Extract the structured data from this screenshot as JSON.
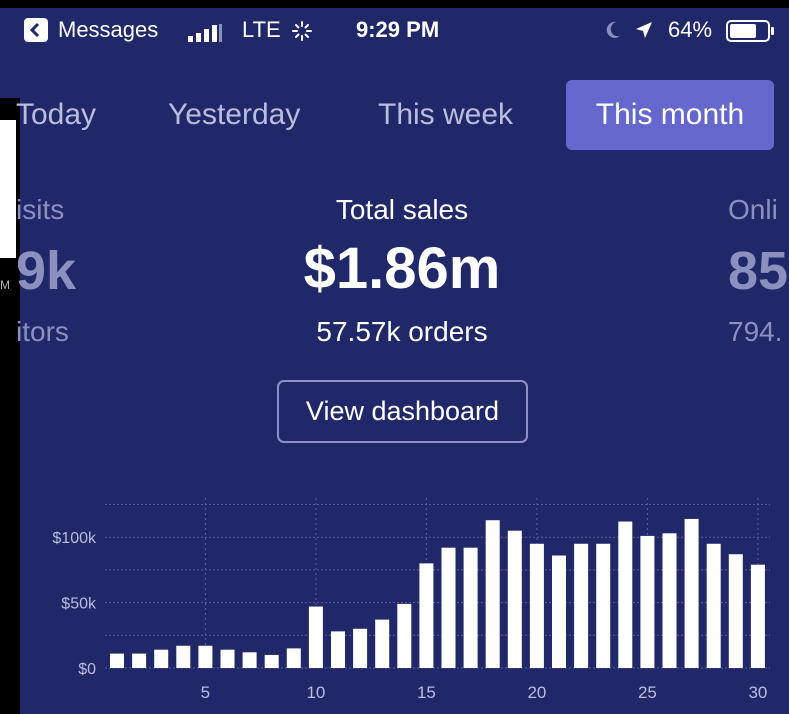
{
  "status_bar": {
    "back_app": "Messages",
    "network": "LTE",
    "time": "9:29 PM",
    "battery_percent": "64%"
  },
  "tabs": [
    {
      "label": "Today",
      "selected": false
    },
    {
      "label": "Yesterday",
      "selected": false
    },
    {
      "label": "This week",
      "selected": false
    },
    {
      "label": "This month",
      "selected": true
    }
  ],
  "left_card": {
    "caption": "isits",
    "value": "9k",
    "sub": "itors"
  },
  "main_card": {
    "caption": "Total sales",
    "value": "$1.86m",
    "sub": "57.57k orders"
  },
  "right_card": {
    "caption": "Onli",
    "value": "85",
    "sub": "794."
  },
  "view_dashboard_label": "View dashboard",
  "left_edge_glyph": "M",
  "colors": {
    "background": "#21286a",
    "tab_selected": "#6667cc",
    "bar": "#ffffff"
  },
  "chart_data": {
    "type": "bar",
    "x": [
      1,
      2,
      3,
      4,
      5,
      6,
      7,
      8,
      9,
      10,
      11,
      12,
      13,
      14,
      15,
      16,
      17,
      18,
      19,
      20,
      21,
      22,
      23,
      24,
      25,
      26,
      27,
      28,
      29,
      30
    ],
    "values": [
      11,
      11,
      14,
      17,
      17,
      14,
      12,
      10,
      15,
      47,
      28,
      30,
      37,
      49,
      80,
      92,
      92,
      113,
      105,
      95,
      86,
      95,
      95,
      112,
      101,
      103,
      114,
      95,
      87,
      79
    ],
    "xticks": [
      5,
      10,
      15,
      20,
      25,
      30
    ],
    "yticks": [
      {
        "value": 0,
        "label": "$0"
      },
      {
        "value": 50,
        "label": "$50k"
      },
      {
        "value": 100,
        "label": "$100k"
      }
    ],
    "ylim": [
      0,
      130
    ],
    "grid": true,
    "unit": "thousands USD"
  }
}
